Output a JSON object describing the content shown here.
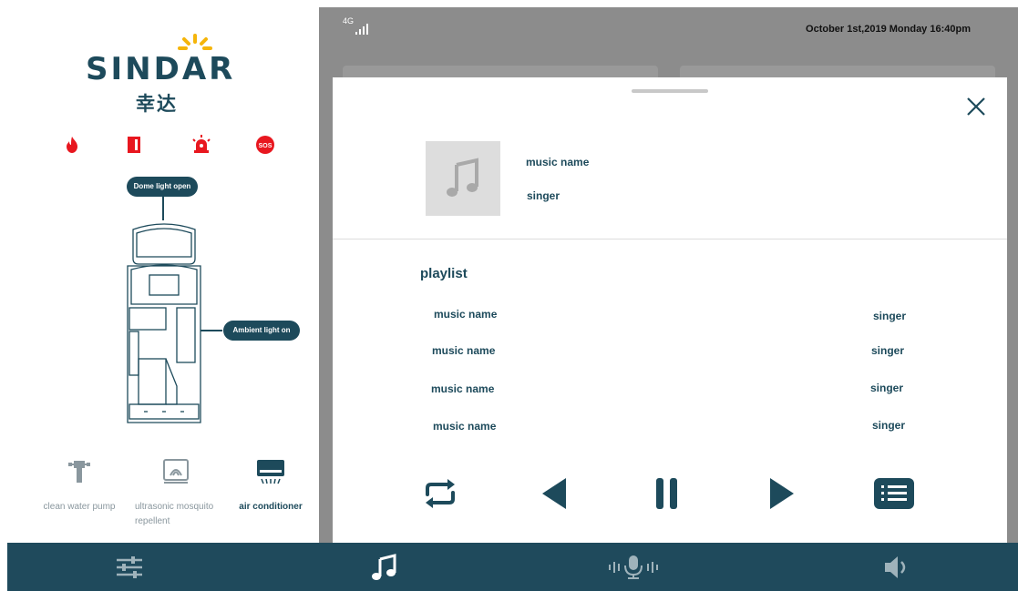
{
  "brand": {
    "name": "SINDAR",
    "name_cn": "幸达"
  },
  "alerts": [
    {
      "icon": "fire-alarm-icon",
      "color": "#e8171f"
    },
    {
      "icon": "door-alarm-icon",
      "color": "#e8171f"
    },
    {
      "icon": "siren-icon",
      "color": "#e8171f"
    },
    {
      "icon": "sos-icon",
      "label": "SOS",
      "color": "#e8171f"
    }
  ],
  "vehicle": {
    "dome_light_status": "Dome light open",
    "ambient_light_status": "Ambient light on"
  },
  "devices": [
    {
      "label": "clean water pump",
      "icon": "water-pump-icon",
      "active": false
    },
    {
      "label": "ultrasonic  mosquito repellent",
      "icon": "mosquito-repellent-icon",
      "active": false
    },
    {
      "label": "air conditioner",
      "icon": "air-conditioner-icon",
      "active": true
    }
  ],
  "status_bar": {
    "signal": "4G",
    "datetime": "October 1st,2019 Monday 16:40pm"
  },
  "now_playing": {
    "title": "music name",
    "singer": "singer"
  },
  "playlist": {
    "heading": "playlist",
    "items": [
      {
        "name": "music name",
        "singer": "singer"
      },
      {
        "name": "music name",
        "singer": "singer"
      },
      {
        "name": "music name",
        "singer": "singer"
      },
      {
        "name": "music name",
        "singer": "singer"
      }
    ]
  },
  "controls": [
    "repeat-icon",
    "previous-icon",
    "pause-icon",
    "next-icon",
    "playlist-icon"
  ],
  "nav": [
    "settings-sliders-icon",
    "music-note-icon",
    "voice-microphone-icon",
    "volume-icon"
  ],
  "colors": {
    "primary": "#1d4a5b",
    "alert": "#e8171f",
    "accent_sun": "#f5b50a",
    "nav_bg": "#1f4a5c",
    "overlay_bg": "#8c8c8c"
  }
}
